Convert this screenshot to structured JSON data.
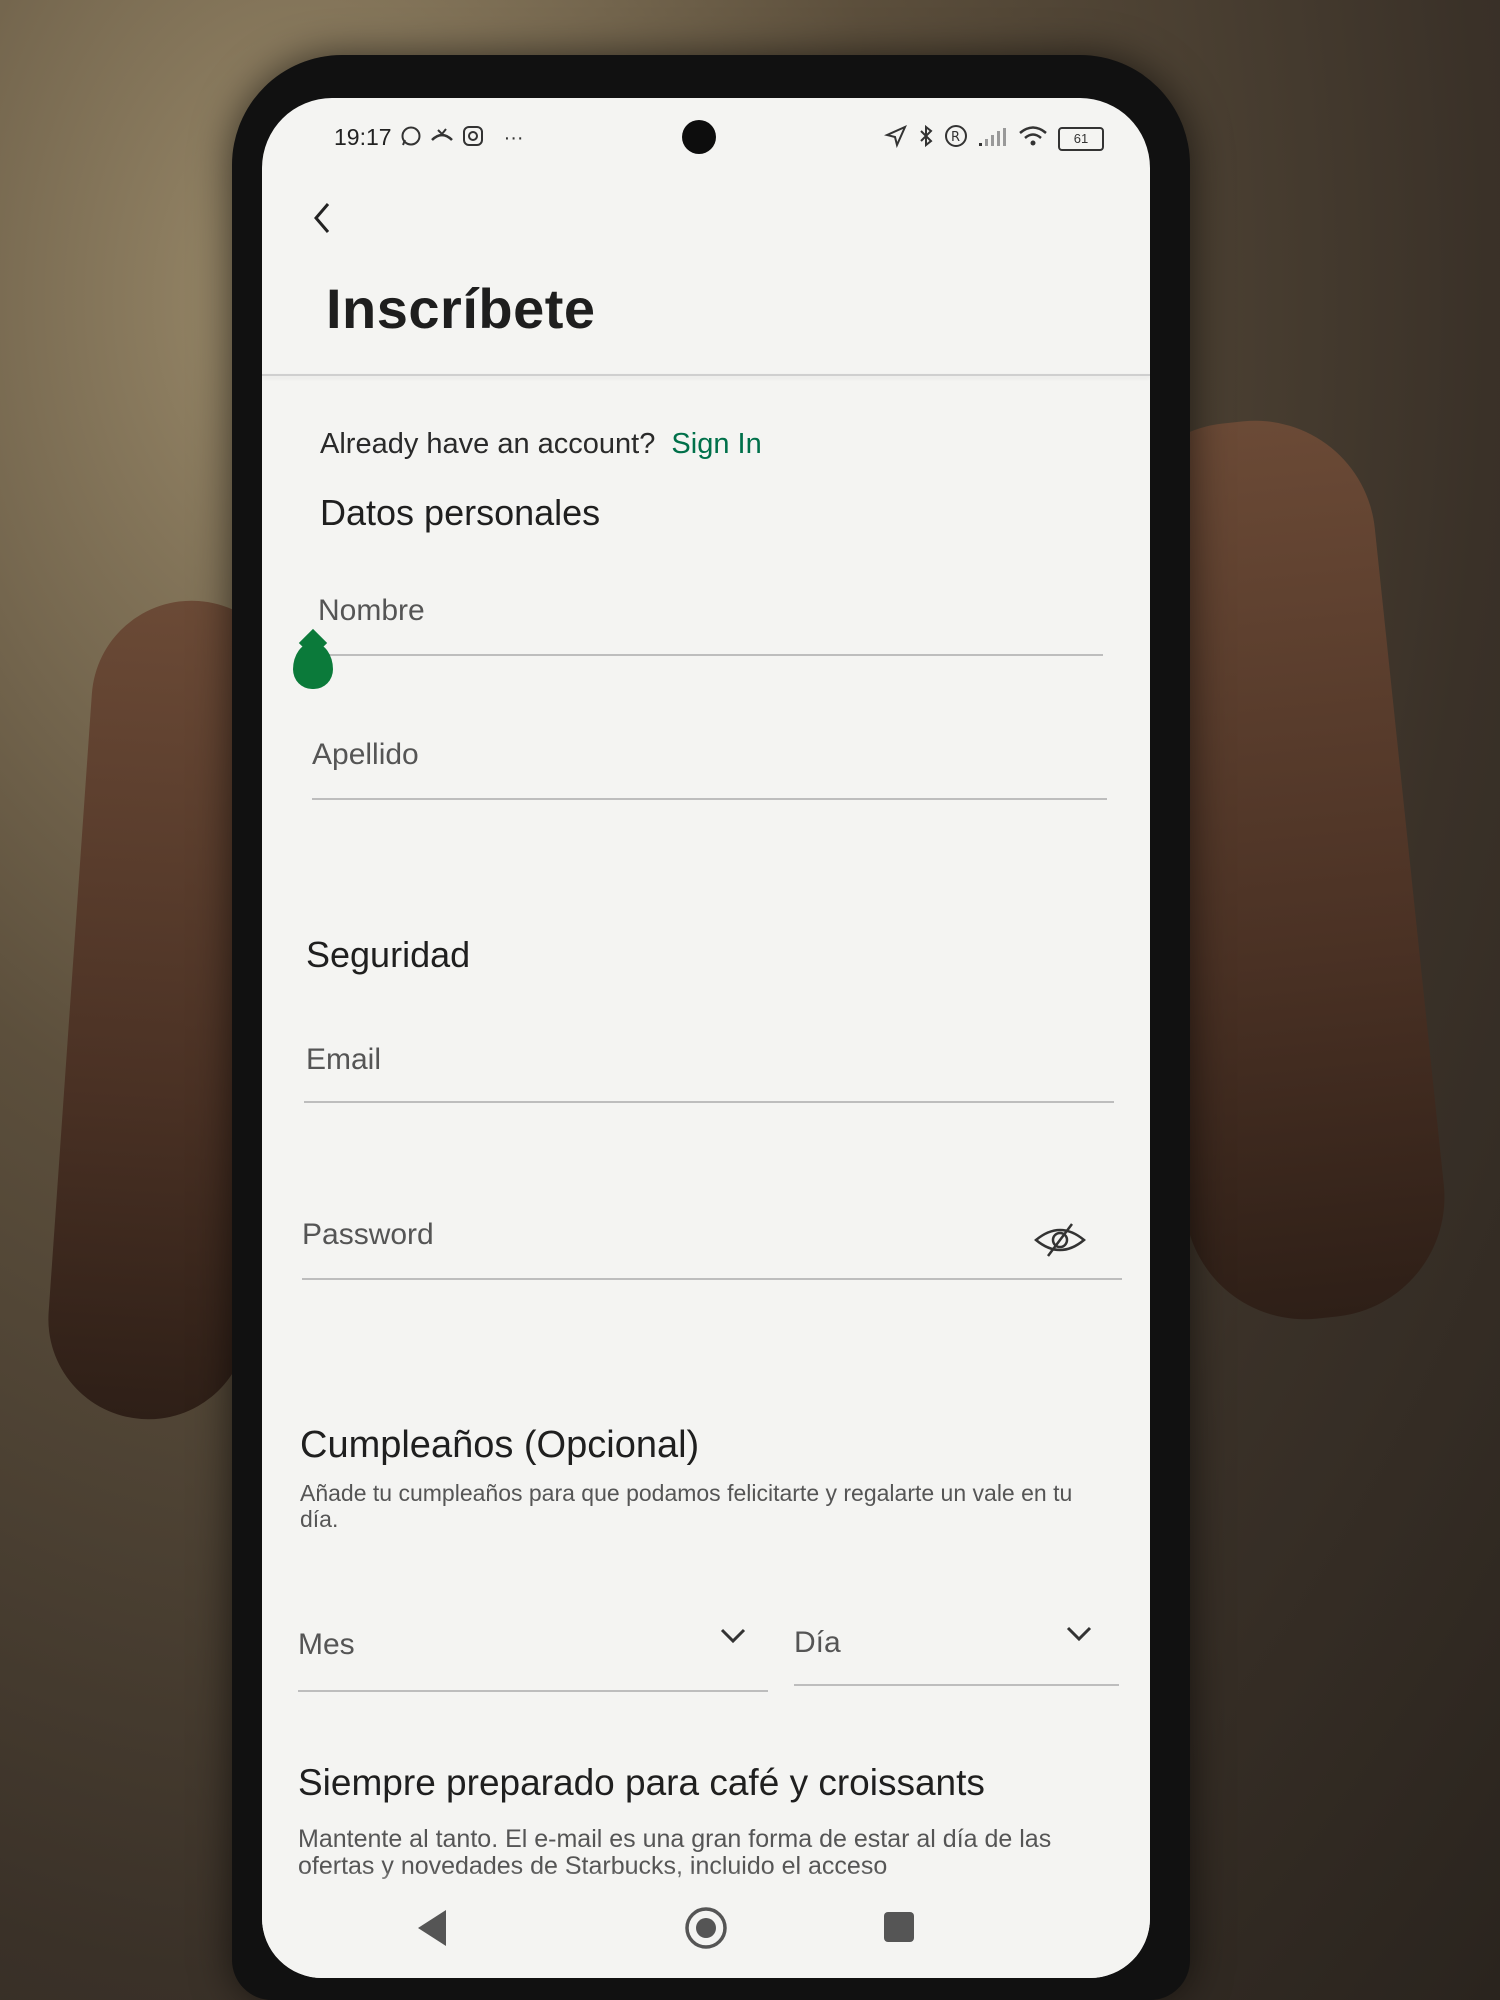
{
  "status": {
    "time": "19:17",
    "left_icons": [
      "whatsapp-icon",
      "missed-call-icon",
      "instagram-icon",
      "more-dots-icon"
    ],
    "right_icons": [
      "location-icon",
      "bluetooth-icon",
      "registered-icon",
      "signal-icon",
      "wifi-icon"
    ],
    "battery": "61"
  },
  "header": {
    "back_icon": "chevron-left-icon",
    "title": "Inscríbete"
  },
  "signin": {
    "prompt": "Already have an account?",
    "link": "Sign In"
  },
  "personal": {
    "title": "Datos personales",
    "first_name_label": "Nombre",
    "last_name_label": "Apellido"
  },
  "security": {
    "title": "Seguridad",
    "email_label": "Email",
    "password_label": "Password",
    "toggle_icon": "eye-off-icon"
  },
  "birthday": {
    "title": "Cumpleaños (Opcional)",
    "description": "Añade tu cumpleaños para que podamos felicitarte y regalarte un vale en tu día.",
    "month_label": "Mes",
    "day_label": "Día"
  },
  "marketing": {
    "title": "Siempre preparado para café y croissants",
    "description": "Mantente al tanto. El e-mail es una gran forma de estar al día de las ofertas y novedades de Starbucks, incluido el acceso"
  },
  "colors": {
    "accent": "#00704A",
    "cursor_handle": "#0b7a3a",
    "screen_bg": "#f4f4f2"
  },
  "nav": [
    "back-triangle-icon",
    "home-circle-icon",
    "recents-square-icon"
  ]
}
